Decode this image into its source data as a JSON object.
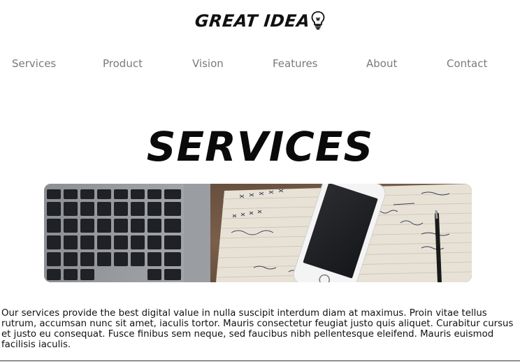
{
  "logo": {
    "text": "GREAT IDEA",
    "icon": "lightbulb-icon"
  },
  "nav": {
    "items": [
      {
        "label": "Services"
      },
      {
        "label": "Product"
      },
      {
        "label": "Vision"
      },
      {
        "label": "Features"
      },
      {
        "label": "About"
      },
      {
        "label": "Contact"
      }
    ]
  },
  "main": {
    "heading": "SERVICES",
    "hero_image": "laptop-phone-notebook-desk-photo",
    "body": "Our services provide the best digital value in nulla suscipit interdum diam at maximus. Proin vitae tellus rutrum, accumsan nunc sit amet, iaculis tortor. Mauris consectetur feugiat justo quis aliquet. Curabitur cursus et justo eu consequat. Fusce finibus sem neque, sed faucibus nibh pellentesque eleifend. Mauris euismod facilisis iaculis."
  },
  "colors": {
    "nav_text": "#7a7a7a",
    "heading": "#0a0a0a",
    "background": "#ffffff"
  }
}
